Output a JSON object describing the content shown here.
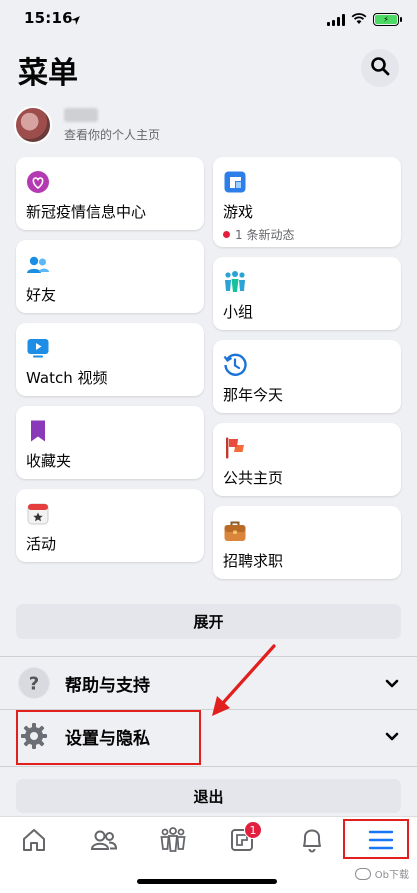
{
  "status": {
    "time": "15:16",
    "battery_icon": "battery-charging-icon"
  },
  "header": {
    "title": "菜单",
    "search_icon": "search-icon"
  },
  "profile": {
    "subtitle": "查看你的个人主页"
  },
  "shortcuts_left": [
    {
      "label": "新冠疫情信息中心",
      "icon": "covid-info-heart-icon"
    },
    {
      "label": "好友",
      "icon": "friends-icon"
    },
    {
      "label": "Watch 视频",
      "icon": "watch-video-icon"
    },
    {
      "label": "收藏夹",
      "icon": "bookmark-icon"
    },
    {
      "label": "活动",
      "icon": "calendar-star-icon"
    }
  ],
  "shortcuts_right": [
    {
      "label": "游戏",
      "sub": "1 条新动态",
      "icon": "gaming-icon"
    },
    {
      "label": "小组",
      "icon": "groups-icon"
    },
    {
      "label": "那年今天",
      "icon": "memories-clock-icon"
    },
    {
      "label": "公共主页",
      "icon": "flag-icon"
    },
    {
      "label": "招聘求职",
      "icon": "briefcase-icon"
    }
  ],
  "expand_label": "展开",
  "sections": [
    {
      "label": "帮助与支持",
      "icon": "help-question-icon"
    },
    {
      "label": "设置与隐私",
      "icon": "settings-gear-icon"
    }
  ],
  "logout_label": "退出",
  "tabbar": {
    "items": [
      "home-icon",
      "friends-tab-icon",
      "groups-tab-icon",
      "pages-tab-icon",
      "notifications-bell-icon",
      "menu-hamburger-icon"
    ],
    "pages_badge": "1"
  },
  "watermark": "Ob下载",
  "colors": {
    "accent": "#1877f2",
    "highlight": "#e21f1f",
    "badge": "#e41e3f"
  }
}
